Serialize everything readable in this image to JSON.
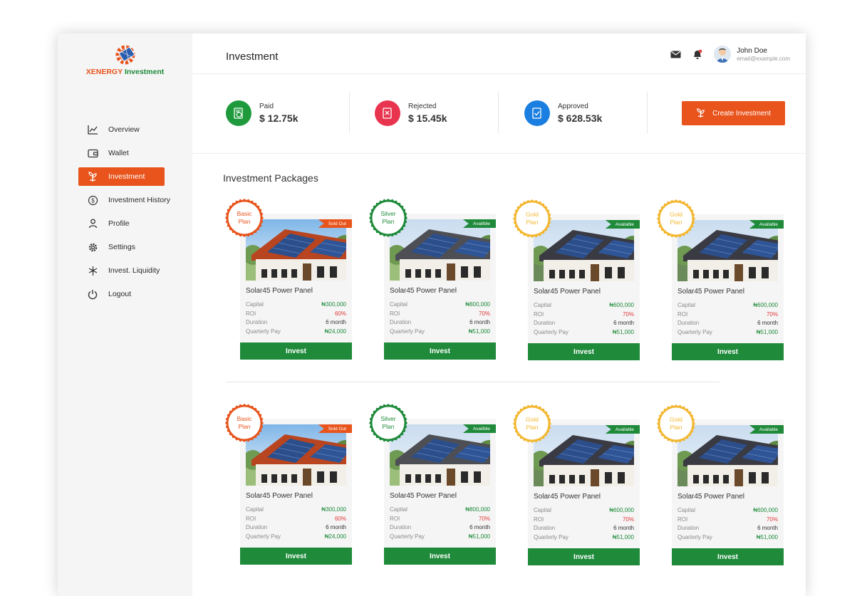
{
  "brand": {
    "name_part1": "XENERGY",
    "name_part2": " Investment",
    "accent": "#e8541c",
    "green": "#1e8a3a"
  },
  "sidebar": {
    "items": [
      {
        "label": "Overview",
        "icon": "chart-line-icon",
        "active": false
      },
      {
        "label": "Wallet",
        "icon": "wallet-icon",
        "active": false
      },
      {
        "label": "Investment",
        "icon": "plant-icon",
        "active": true
      },
      {
        "label": "Investment History",
        "icon": "dollar-cycle-icon",
        "active": false
      },
      {
        "label": "Profile",
        "icon": "user-icon",
        "active": false
      },
      {
        "label": "Settings",
        "icon": "gear-icon",
        "active": false
      },
      {
        "label": "Invest. Liquidity",
        "icon": "liquidity-icon",
        "active": false
      },
      {
        "label": "Logout",
        "icon": "power-icon",
        "active": false
      }
    ]
  },
  "header": {
    "title": "Investment",
    "user": {
      "name": "John Doe",
      "email": "email@example.com"
    }
  },
  "stats": [
    {
      "label": "Paid",
      "value": "$ 12.75k",
      "color": "#1e9a3c"
    },
    {
      "label": "Rejected",
      "value": "$ 15.45k",
      "color": "#e8344e"
    },
    {
      "label": "Approved",
      "value": "$ 628.53k",
      "color": "#1a7fe0"
    }
  ],
  "create_button": "Create Investment",
  "section_title": "Investment Packages",
  "cards": [
    {
      "plan_line1": "Basic",
      "plan_line2": "Plan",
      "plan_color": "#e8541c",
      "status": "Sold Out",
      "status_color": "#e8541c",
      "title": "Solar45 Power Panel",
      "capital": "₦300,000",
      "roi": "60%",
      "duration": "6 month",
      "quarterly": "₦24,000",
      "button": "Invest",
      "k_capital": "Capital",
      "k_roi": "ROI",
      "k_duration": "Duration",
      "k_quarterly": "Quarterly Pay",
      "image": "house-red-roof"
    },
    {
      "plan_line1": "Silver",
      "plan_line2": "Plan",
      "plan_color": "#1e8a3a",
      "status": "Availible",
      "status_color": "#1e8a3a",
      "title": "Solar45 Power Panel",
      "capital": "₦800,000",
      "roi": "70%",
      "duration": "6 month",
      "quarterly": "₦51,000",
      "button": "Invest",
      "k_capital": "Capital",
      "k_roi": "ROI",
      "k_duration": "Duration",
      "k_quarterly": "Quarterly Pay",
      "image": "house-grey-roof"
    },
    {
      "plan_line1": "Gold",
      "plan_line2": "Plan",
      "plan_color": "#f3b731",
      "status": "Available",
      "status_color": "#1e8a3a",
      "title": "Solar45 Power Panel",
      "capital": "₦600,000",
      "roi": "70%",
      "duration": "6 month",
      "quarterly": "₦51,000",
      "button": "Invest",
      "k_capital": "Capital",
      "k_roi": "ROI",
      "k_duration": "Duration",
      "k_quarterly": "Quarterly Pay",
      "image": "house-dark-roof"
    },
    {
      "plan_line1": "Gold",
      "plan_line2": "Plan",
      "plan_color": "#f3b731",
      "status": "Available",
      "status_color": "#1e8a3a",
      "title": "Solar45 Power Panel",
      "capital": "₦600,000",
      "roi": "70%",
      "duration": "6 month",
      "quarterly": "₦51,000",
      "button": "Invest",
      "k_capital": "Capital",
      "k_roi": "ROI",
      "k_duration": "Duration",
      "k_quarterly": "Quarterly Pay",
      "image": "house-dark-roof"
    },
    {
      "plan_line1": "Basic",
      "plan_line2": "Plan",
      "plan_color": "#e8541c",
      "status": "Sold Out",
      "status_color": "#e8541c",
      "title": "Solar45 Power Panel",
      "capital": "₦300,000",
      "roi": "60%",
      "duration": "6 month",
      "quarterly": "₦24,000",
      "button": "Invest",
      "k_capital": "Capital",
      "k_roi": "ROI",
      "k_duration": "Duration",
      "k_quarterly": "Quarterly Pay",
      "image": "house-red-roof"
    },
    {
      "plan_line1": "Silver",
      "plan_line2": "Plan",
      "plan_color": "#1e8a3a",
      "status": "Availible",
      "status_color": "#1e8a3a",
      "title": "Solar45 Power Panel",
      "capital": "₦800,000",
      "roi": "70%",
      "duration": "6 month",
      "quarterly": "₦51,000",
      "button": "Invest",
      "k_capital": "Capital",
      "k_roi": "ROI",
      "k_duration": "Duration",
      "k_quarterly": "Quarterly Pay",
      "image": "house-grey-roof"
    },
    {
      "plan_line1": "Gold",
      "plan_line2": "Plan",
      "plan_color": "#f3b731",
      "status": "Available",
      "status_color": "#1e8a3a",
      "title": "Solar45 Power Panel",
      "capital": "₦600,000",
      "roi": "70%",
      "duration": "6 month",
      "quarterly": "₦51,000",
      "button": "Invest",
      "k_capital": "Capital",
      "k_roi": "ROI",
      "k_duration": "Duration",
      "k_quarterly": "Quarterly Pay",
      "image": "house-dark-roof"
    },
    {
      "plan_line1": "Gold",
      "plan_line2": "Plan",
      "plan_color": "#f3b731",
      "status": "Available",
      "status_color": "#1e8a3a",
      "title": "Solar45 Power Panel",
      "capital": "₦600,000",
      "roi": "70%",
      "duration": "6 month",
      "quarterly": "₦51,000",
      "button": "Invest",
      "k_capital": "Capital",
      "k_roi": "ROI",
      "k_duration": "Duration",
      "k_quarterly": "Quarterly Pay",
      "image": "house-dark-roof"
    }
  ]
}
